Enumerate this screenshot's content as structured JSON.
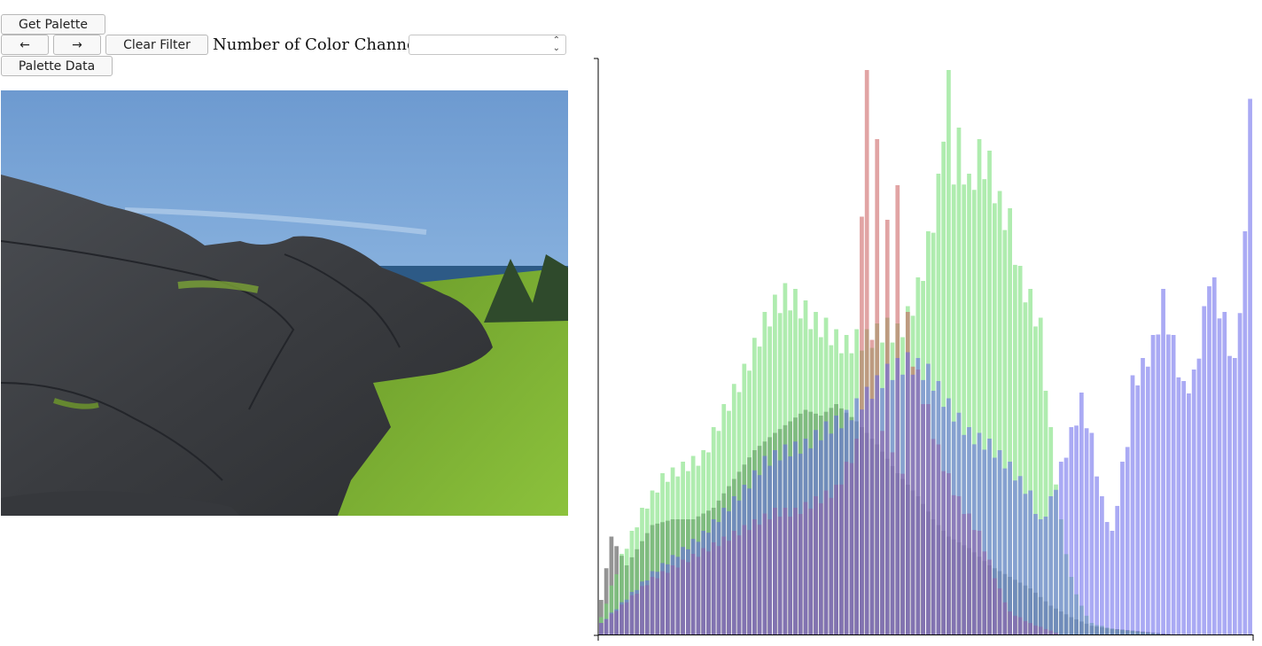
{
  "toolbar": {
    "get_palette_label": "Get Palette",
    "prev_label": "←",
    "next_label": "→",
    "clear_filter_label": "Clear Filter",
    "channels_label": "Number of Color Channels:",
    "channels_value": "",
    "palette_data_label": "Palette Data"
  },
  "image": {
    "description_icon": "landscape-photo"
  },
  "chart_data": {
    "type": "bar",
    "title": "",
    "xlabel": "",
    "ylabel": "",
    "grid": false,
    "bins": 128,
    "colors": {
      "red": "rgba(200,90,90,0.55)",
      "green": "rgba(110,220,110,0.55)",
      "blue": "rgba(100,100,235,0.55)",
      "gray": "rgba(60,60,60,0.55)"
    },
    "series": [
      {
        "key": "gray",
        "anchors": [
          [
            0,
            0.06
          ],
          [
            2,
            0.17
          ],
          [
            5,
            0.12
          ],
          [
            10,
            0.19
          ],
          [
            14,
            0.2
          ],
          [
            18,
            0.2
          ],
          [
            22,
            0.22
          ],
          [
            26,
            0.27
          ],
          [
            30,
            0.32
          ],
          [
            34,
            0.35
          ],
          [
            37,
            0.37
          ],
          [
            40,
            0.39
          ],
          [
            43,
            0.38
          ],
          [
            46,
            0.4
          ],
          [
            50,
            0.37
          ],
          [
            54,
            0.33
          ],
          [
            58,
            0.28
          ],
          [
            62,
            0.24
          ],
          [
            65,
            0.2
          ],
          [
            68,
            0.17
          ],
          [
            72,
            0.15
          ],
          [
            76,
            0.12
          ],
          [
            80,
            0.1
          ],
          [
            84,
            0.08
          ],
          [
            88,
            0.05
          ],
          [
            92,
            0.03
          ],
          [
            96,
            0.015
          ],
          [
            100,
            0.01
          ],
          [
            106,
            0.005
          ],
          [
            112,
            0.0
          ],
          [
            127,
            0.0
          ]
        ]
      },
      {
        "key": "green",
        "anchors": [
          [
            0,
            0.03
          ],
          [
            4,
            0.14
          ],
          [
            8,
            0.22
          ],
          [
            12,
            0.28
          ],
          [
            16,
            0.3
          ],
          [
            20,
            0.32
          ],
          [
            24,
            0.4
          ],
          [
            28,
            0.47
          ],
          [
            32,
            0.56
          ],
          [
            34,
            0.59
          ],
          [
            36,
            0.61
          ],
          [
            38,
            0.6
          ],
          [
            40,
            0.58
          ],
          [
            42,
            0.56
          ],
          [
            44,
            0.55
          ],
          [
            46,
            0.53
          ],
          [
            48,
            0.52
          ],
          [
            50,
            0.53
          ],
          [
            52,
            0.53
          ],
          [
            54,
            0.54
          ],
          [
            56,
            0.55
          ],
          [
            58,
            0.54
          ],
          [
            60,
            0.57
          ],
          [
            62,
            0.62
          ],
          [
            64,
            0.7
          ],
          [
            66,
            0.8
          ],
          [
            67,
            0.92
          ],
          [
            68,
            0.98
          ],
          [
            69,
            0.84
          ],
          [
            70,
            0.88
          ],
          [
            72,
            0.8
          ],
          [
            74,
            0.86
          ],
          [
            76,
            0.84
          ],
          [
            78,
            0.77
          ],
          [
            80,
            0.74
          ],
          [
            82,
            0.64
          ],
          [
            84,
            0.6
          ],
          [
            86,
            0.55
          ],
          [
            88,
            0.36
          ],
          [
            90,
            0.2
          ],
          [
            92,
            0.1
          ],
          [
            94,
            0.05
          ],
          [
            96,
            0.02
          ],
          [
            100,
            0.01
          ],
          [
            110,
            0.0
          ],
          [
            127,
            0.0
          ]
        ]
      },
      {
        "key": "red",
        "anchors": [
          [
            0,
            0.02
          ],
          [
            10,
            0.1
          ],
          [
            20,
            0.15
          ],
          [
            30,
            0.2
          ],
          [
            34,
            0.22
          ],
          [
            38,
            0.22
          ],
          [
            42,
            0.24
          ],
          [
            44,
            0.25
          ],
          [
            46,
            0.26
          ],
          [
            48,
            0.3
          ],
          [
            50,
            0.34
          ],
          [
            51,
            0.78
          ],
          [
            52,
            0.98
          ],
          [
            53,
            0.55
          ],
          [
            54,
            0.86
          ],
          [
            55,
            0.38
          ],
          [
            56,
            0.72
          ],
          [
            57,
            0.34
          ],
          [
            58,
            0.78
          ],
          [
            59,
            0.3
          ],
          [
            60,
            0.56
          ],
          [
            61,
            0.5
          ],
          [
            62,
            0.46
          ],
          [
            64,
            0.4
          ],
          [
            66,
            0.33
          ],
          [
            68,
            0.28
          ],
          [
            70,
            0.24
          ],
          [
            72,
            0.21
          ],
          [
            74,
            0.18
          ],
          [
            76,
            0.13
          ],
          [
            78,
            0.08
          ],
          [
            80,
            0.04
          ],
          [
            84,
            0.02
          ],
          [
            90,
            0.0
          ],
          [
            127,
            0.0
          ]
        ]
      },
      {
        "key": "blue",
        "anchors": [
          [
            0,
            0.02
          ],
          [
            10,
            0.11
          ],
          [
            20,
            0.18
          ],
          [
            28,
            0.26
          ],
          [
            32,
            0.31
          ],
          [
            36,
            0.33
          ],
          [
            40,
            0.34
          ],
          [
            44,
            0.37
          ],
          [
            48,
            0.39
          ],
          [
            52,
            0.43
          ],
          [
            56,
            0.47
          ],
          [
            60,
            0.49
          ],
          [
            64,
            0.47
          ],
          [
            68,
            0.41
          ],
          [
            72,
            0.36
          ],
          [
            76,
            0.34
          ],
          [
            80,
            0.3
          ],
          [
            84,
            0.25
          ],
          [
            86,
            0.2
          ],
          [
            88,
            0.24
          ],
          [
            90,
            0.3
          ],
          [
            92,
            0.36
          ],
          [
            94,
            0.42
          ],
          [
            96,
            0.35
          ],
          [
            98,
            0.24
          ],
          [
            100,
            0.18
          ],
          [
            102,
            0.3
          ],
          [
            103,
            0.35
          ],
          [
            104,
            0.45
          ],
          [
            106,
            0.48
          ],
          [
            108,
            0.52
          ],
          [
            110,
            0.6
          ],
          [
            112,
            0.52
          ],
          [
            114,
            0.44
          ],
          [
            116,
            0.46
          ],
          [
            118,
            0.57
          ],
          [
            119,
            0.65
          ],
          [
            120,
            0.62
          ],
          [
            122,
            0.56
          ],
          [
            124,
            0.48
          ],
          [
            125,
            0.6
          ],
          [
            126,
            0.7
          ],
          [
            127,
            1.0
          ]
        ]
      }
    ]
  }
}
